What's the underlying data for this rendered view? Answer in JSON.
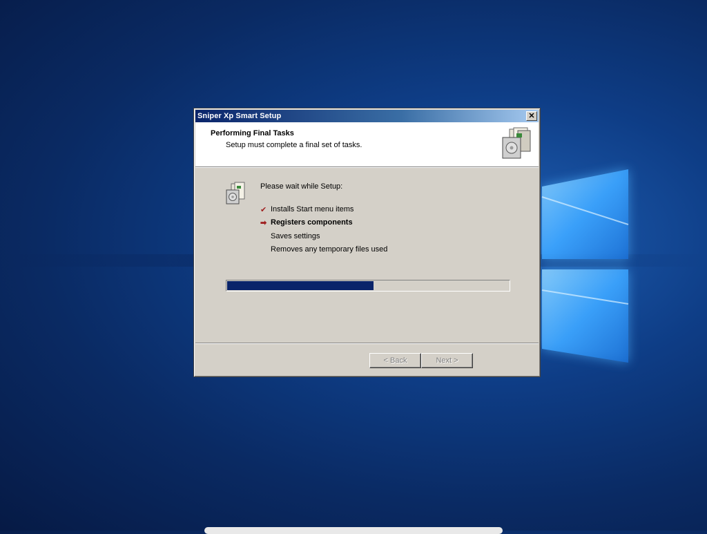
{
  "window": {
    "title": "Sniper Xp Smart Setup",
    "close_label": "✕"
  },
  "header": {
    "title": "Performing Final Tasks",
    "subtitle": "Setup must complete a final set of tasks."
  },
  "main": {
    "wait_text": "Please wait while Setup:",
    "tasks": [
      {
        "label": "Installs Start menu items",
        "status": "done",
        "mark": "✔"
      },
      {
        "label": "Registers components",
        "status": "current",
        "mark": "➡"
      },
      {
        "label": "Saves settings",
        "status": "pending",
        "mark": ""
      },
      {
        "label": "Removes any temporary files used",
        "status": "pending",
        "mark": ""
      }
    ],
    "progress_fraction": 0.52
  },
  "footer": {
    "back_label": "< Back",
    "next_label": "Next >"
  },
  "colors": {
    "titlebar_start": "#0a246a",
    "titlebar_end": "#a6caf0",
    "dialog_face": "#d4d0c8",
    "progress_fill": "#0a246a",
    "desktop": "#0e3d86"
  },
  "icons": {
    "header_icon": "setup-box-icon",
    "body_icon": "setup-box-icon",
    "close_icon": "close-icon"
  }
}
